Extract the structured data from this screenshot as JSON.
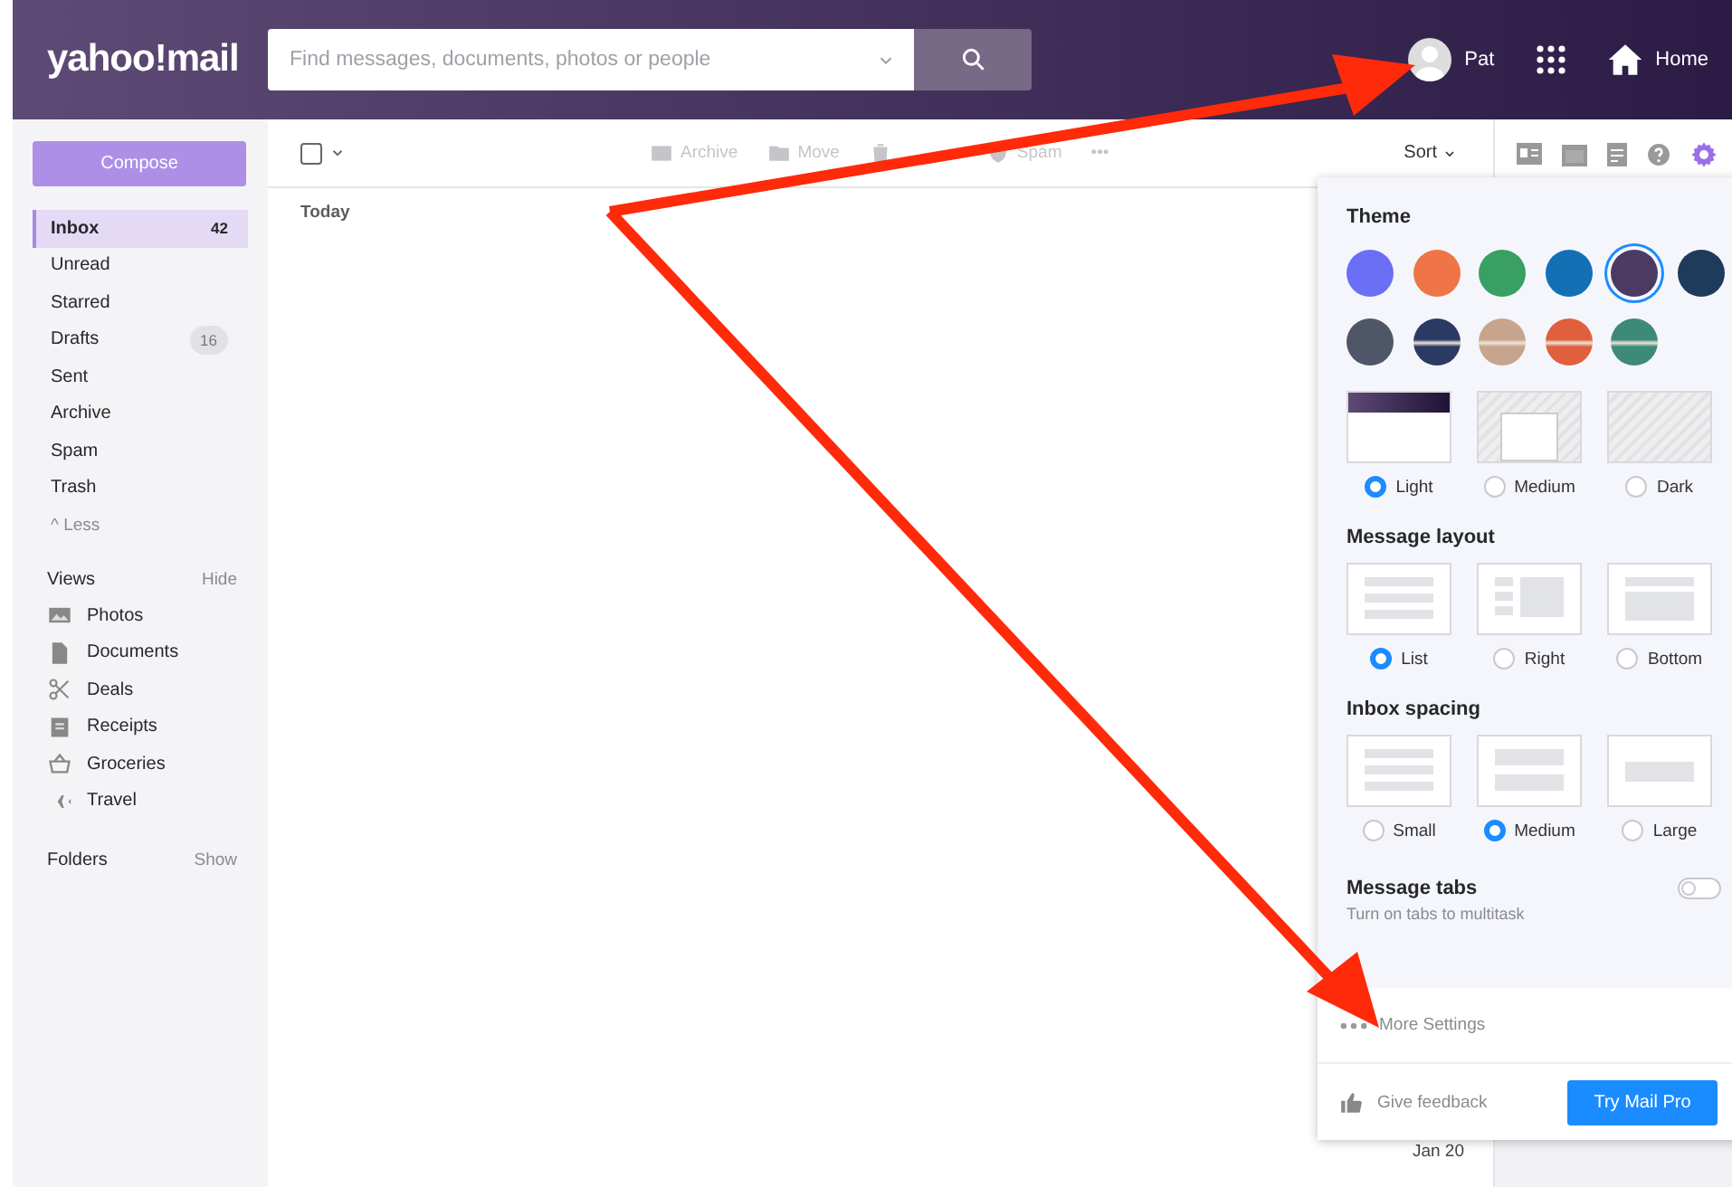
{
  "header": {
    "logo": "yahoo!mail",
    "search": {
      "placeholder": "Find messages, documents, photos or people"
    },
    "user": "Pat",
    "home": "Home"
  },
  "sidebar": {
    "compose": "Compose",
    "folders": [
      {
        "label": "Inbox",
        "count": "42",
        "selected": true
      },
      {
        "label": "Unread",
        "selected": false
      },
      {
        "label": "Starred",
        "selected": false
      },
      {
        "label": "Drafts",
        "count": "16",
        "selected": false
      },
      {
        "label": "Sent",
        "selected": false
      },
      {
        "label": "Archive",
        "selected": false
      },
      {
        "label": "Spam",
        "selected": false
      },
      {
        "label": "Trash",
        "selected": false
      }
    ],
    "less": "^ Less",
    "views": {
      "title": "Views",
      "action": "Hide",
      "items": [
        {
          "label": "Photos",
          "kind": "photos"
        },
        {
          "label": "Documents",
          "kind": "documents"
        },
        {
          "label": "Deals",
          "kind": "deals"
        },
        {
          "label": "Receipts",
          "kind": "receipts"
        },
        {
          "label": "Groceries",
          "kind": "groceries"
        },
        {
          "label": "Travel",
          "kind": "travel"
        }
      ]
    },
    "folders_section": {
      "title": "Folders",
      "action": "Show"
    }
  },
  "toolbar": {
    "select_all": {
      "checked": false
    },
    "actions": [
      {
        "kind": "archive",
        "label": "Archive",
        "disabled": true
      },
      {
        "kind": "move",
        "label": "Move",
        "disabled": true
      },
      {
        "kind": "delete"
      },
      {
        "kind": "spam",
        "label": "Spam",
        "disabled": true
      },
      {
        "kind": "more",
        "label": "•••",
        "disabled": true
      }
    ],
    "sort": "Sort"
  },
  "list": {
    "group": "Today",
    "dates": [
      "Jan 20"
    ]
  },
  "settings": {
    "theme": {
      "title": "Theme",
      "swatches": [
        {
          "kind": "solid",
          "color": "#6b6ff5",
          "selected": false
        },
        {
          "kind": "solid",
          "color": "#ef7548",
          "selected": false
        },
        {
          "kind": "solid",
          "color": "#3a9f63",
          "selected": false
        },
        {
          "kind": "solid",
          "color": "#1470b5",
          "selected": false
        },
        {
          "kind": "solid",
          "color": "#4b3a62",
          "selected": true
        },
        {
          "kind": "solid",
          "color": "#1f3b5b",
          "selected": false
        },
        {
          "kind": "solid",
          "color": "#4f5667",
          "selected": false
        },
        {
          "kind": "scene",
          "color": "#2b3a62",
          "selected": false
        },
        {
          "kind": "scene",
          "color": "#c7a48c",
          "selected": false
        },
        {
          "kind": "scene",
          "color": "#e0603e",
          "selected": false
        },
        {
          "kind": "scene",
          "color": "#3d8a78",
          "selected": false
        }
      ],
      "modes": [
        {
          "kind": "light",
          "label": "Light",
          "selected": true
        },
        {
          "kind": "medium",
          "label": "Medium",
          "selected": false
        },
        {
          "kind": "dark",
          "label": "Dark",
          "selected": false
        }
      ]
    },
    "layout": {
      "title": "Message layout",
      "options": [
        {
          "kind": "list",
          "label": "List",
          "selected": true
        },
        {
          "kind": "right",
          "label": "Right",
          "selected": false
        },
        {
          "kind": "bottom",
          "label": "Bottom",
          "selected": false
        }
      ]
    },
    "spacing": {
      "title": "Inbox spacing",
      "options": [
        {
          "kind": "small",
          "label": "Small",
          "selected": false
        },
        {
          "kind": "medium",
          "label": "Medium",
          "selected": true
        },
        {
          "kind": "large",
          "label": "Large",
          "selected": false
        }
      ]
    },
    "tabs": {
      "title": "Message tabs",
      "subtitle": "Turn on tabs to multitask",
      "on": false
    },
    "more": "More Settings",
    "feedback": "Give feedback",
    "pro": "Try Mail Pro"
  }
}
